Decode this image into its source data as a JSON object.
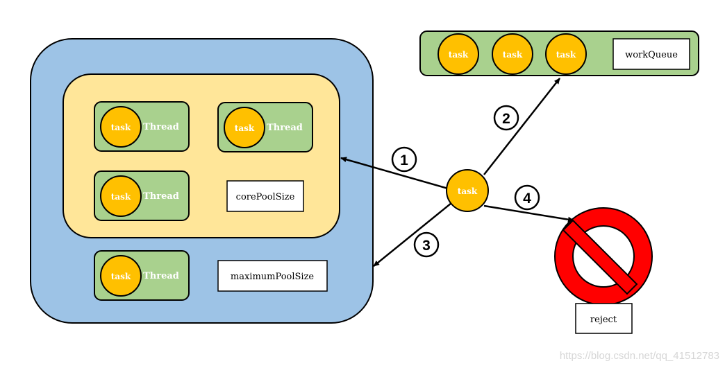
{
  "colors": {
    "pool": "#9DC3E6",
    "core": "#FFE699",
    "thread": "#A9D18E",
    "task": "#FFC000",
    "reject": "#FF0000"
  },
  "pool": {
    "core_threads": [
      {
        "task": "task",
        "thread": "Thread"
      },
      {
        "task": "task",
        "thread": "Thread"
      },
      {
        "task": "task",
        "thread": "Thread"
      }
    ],
    "core_label": "corePoolSize",
    "extra_thread": {
      "task": "task",
      "thread": "Thread"
    },
    "max_label": "maximumPoolSize"
  },
  "queue": {
    "tasks": [
      "task",
      "task",
      "task"
    ],
    "label": "workQueue"
  },
  "incoming_task": "task",
  "steps": [
    "1",
    "2",
    "3",
    "4"
  ],
  "reject": {
    "label": "reject",
    "icon": "prohibited-icon"
  },
  "watermark": "https://blog.csdn.net/qq_41512783"
}
